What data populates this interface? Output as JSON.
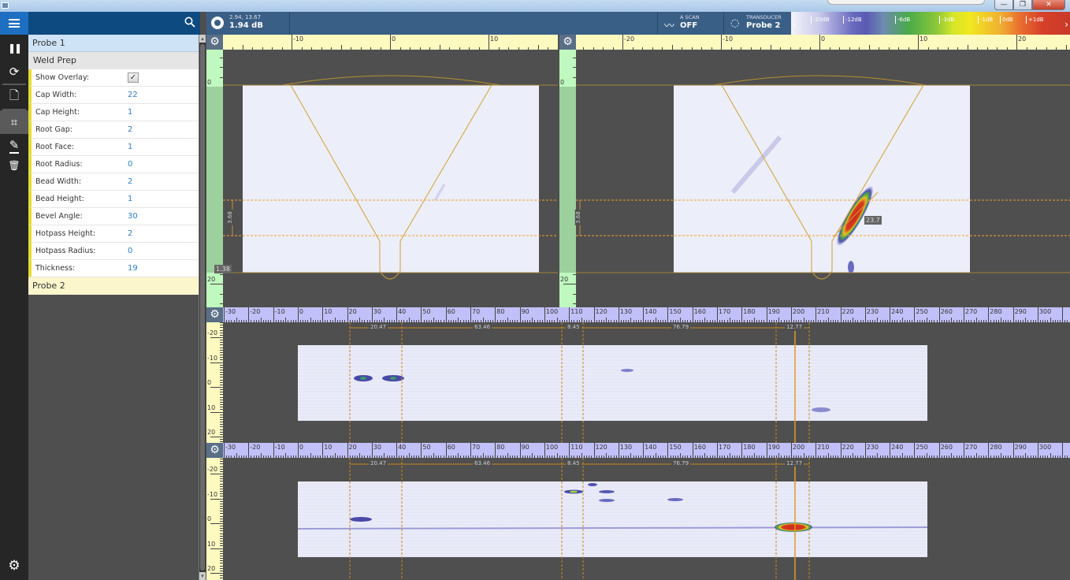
{
  "window": {
    "min_label": "—",
    "max_label": "❐",
    "close_label": "✕"
  },
  "toolbar_left": {
    "menu_icon": "hamburger-icon",
    "items": [
      {
        "name": "pause",
        "icon": "pause-icon",
        "glyph": "❚❚"
      },
      {
        "name": "refresh",
        "icon": "refresh-icon",
        "glyph": "⟳"
      },
      {
        "name": "new-file",
        "icon": "new-file-icon",
        "glyph": "🗋"
      },
      {
        "name": "crop",
        "icon": "crop-icon",
        "glyph": "⌗"
      },
      {
        "name": "edit",
        "icon": "pencil-icon",
        "glyph": "✎"
      },
      {
        "name": "delete",
        "icon": "trash-icon",
        "glyph": "🗑"
      }
    ],
    "settings_glyph": "⚙"
  },
  "top": {
    "readout_coords": "2.94, 13.67",
    "readout_value": "1.94 dB",
    "ascan_label": "A SCAN",
    "ascan_value": "OFF",
    "transducer_label": "TRANSDUCER",
    "transducer_value": "Probe 2",
    "colorbar_labels": [
      "-20dB",
      "-12dB",
      "-6dB",
      "-3dB",
      "-1dB",
      "0dB",
      "+1dB"
    ],
    "colorbar_left": "‹",
    "colorbar_right": "›"
  },
  "panel": {
    "probe1": "Probe 1",
    "section": "Weld Prep",
    "show_overlay_label": "Show Overlay:",
    "show_overlay_checked": "✓",
    "props": [
      {
        "label": "Cap Width:",
        "value": "22"
      },
      {
        "label": "Cap Height:",
        "value": "1"
      },
      {
        "label": "Root Gap:",
        "value": "2"
      },
      {
        "label": "Root Face:",
        "value": "1"
      },
      {
        "label": "Root Radius:",
        "value": "0"
      },
      {
        "label": "Bead Width:",
        "value": "2"
      },
      {
        "label": "Bead Height:",
        "value": "1"
      },
      {
        "label": "Bevel Angle:",
        "value": "30"
      },
      {
        "label": "Hotpass Height:",
        "value": "2"
      },
      {
        "label": "Hotpass Radius:",
        "value": "0"
      },
      {
        "label": "Thickness:",
        "value": "19"
      }
    ],
    "probe2": "Probe 2"
  },
  "views": {
    "sscan1": {
      "hticks": [
        "-10",
        "0",
        "10"
      ],
      "vticks": [
        "0",
        "10",
        "20"
      ],
      "gate_height": "3.68",
      "depth_badge": "1.38"
    },
    "sscan2": {
      "hticks": [
        "-20",
        "-10",
        "0",
        "10",
        "20"
      ],
      "vticks": [
        "0",
        "10",
        "20"
      ],
      "gate_height": "3.68",
      "amplitude_badge": "23.7"
    },
    "cscan": {
      "hticks": [
        "-30",
        "-20",
        "-10",
        "0",
        "10",
        "20",
        "30",
        "40",
        "50",
        "60",
        "70",
        "80",
        "90",
        "100",
        "110",
        "120",
        "130",
        "140",
        "150",
        "160",
        "170",
        "180",
        "190",
        "200",
        "210",
        "220",
        "230",
        "240",
        "250",
        "260",
        "270",
        "280",
        "290",
        "300"
      ],
      "vticks": [
        "-20",
        "-10",
        "0",
        "10",
        "20"
      ],
      "measurements": [
        "20.47",
        "63.46",
        "8.45",
        "76.79",
        "12.77"
      ]
    }
  }
}
